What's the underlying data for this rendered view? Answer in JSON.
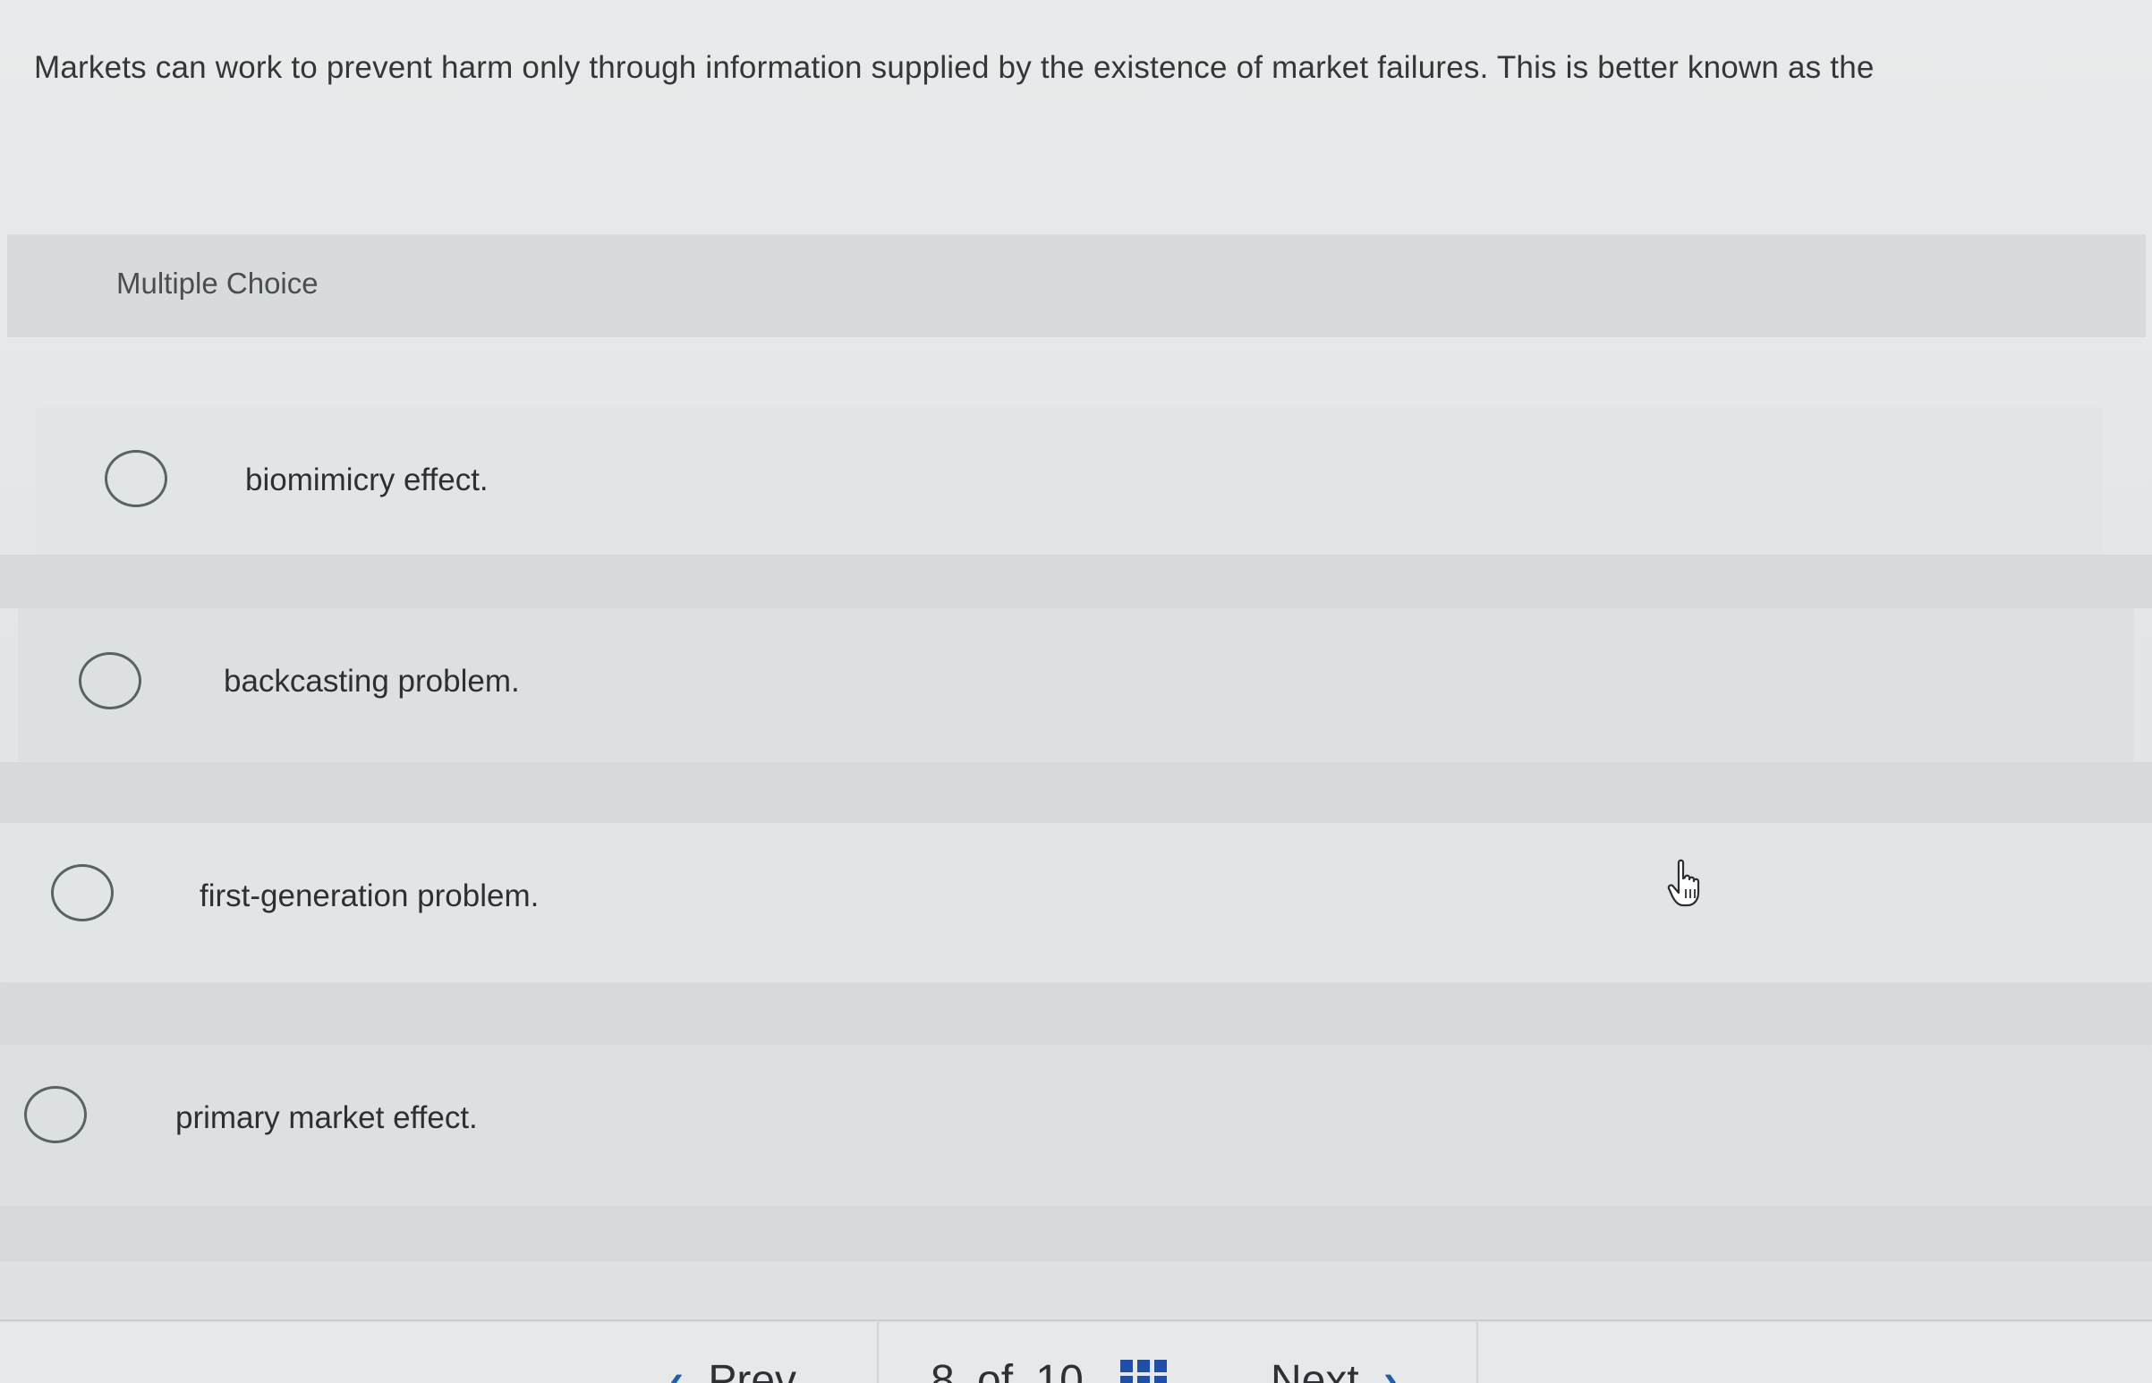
{
  "question": {
    "text": "Markets can work to prevent harm only through information supplied by the existence of market failures. This is better known as the"
  },
  "answer_section": {
    "label": "Multiple Choice",
    "options": [
      {
        "label": "biomimicry effect."
      },
      {
        "label": "backcasting problem."
      },
      {
        "label": "first-generation problem."
      },
      {
        "label": "primary market effect."
      }
    ]
  },
  "footer": {
    "prev_label": "Prev",
    "page_current": "8",
    "page_of": "of",
    "page_total": "10",
    "next_label": "Next",
    "prev_icon": "chevron-left-icon",
    "next_icon": "chevron-right-icon",
    "grid_icon": "question-grid-icon",
    "accent_color": "#1b5fb0"
  }
}
